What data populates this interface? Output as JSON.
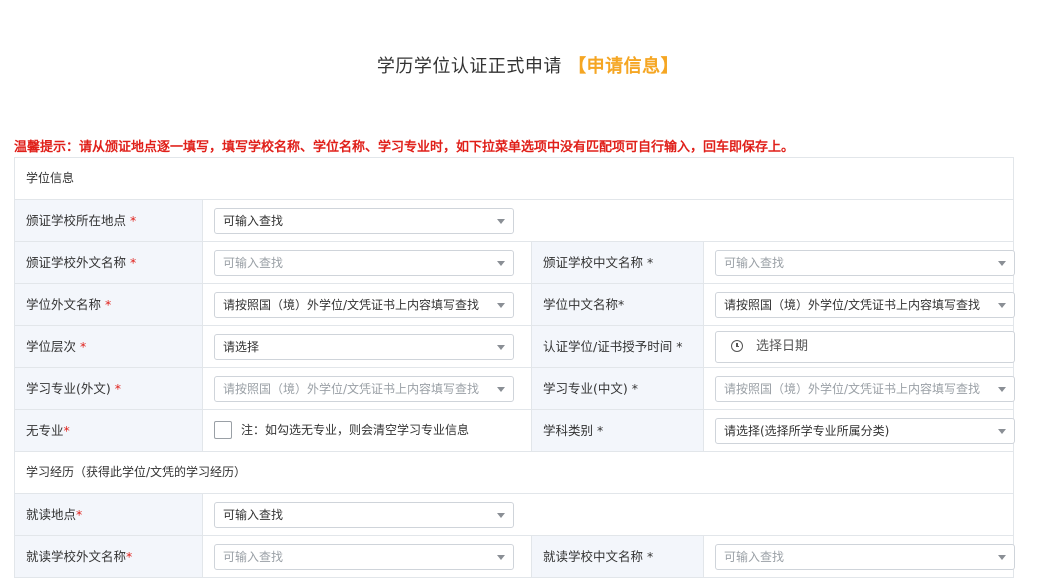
{
  "page": {
    "title_main": "学历学位认证正式申请",
    "title_highlight": "【申请信息】"
  },
  "tip": "温馨提示：请从颁证地点逐一填写，填写学校名称、学位名称、学习专业时，如下拉菜单选项中没有匹配项可自行输入，回车即保存上。",
  "colors": {
    "highlight": "#f5a623",
    "warning": "#e0201a",
    "label_bg": "#f3f6fb"
  },
  "sections": {
    "degree_info": "学位信息",
    "study_experience": "学习经历（获得此学位/文凭的学习经历）"
  },
  "fields": {
    "issuing_location": {
      "label": "颁证学校所在地点",
      "req": "*",
      "value": "可输入查找"
    },
    "issuing_school_foreign": {
      "label": "颁证学校外文名称",
      "req": "*",
      "placeholder": "可输入查找"
    },
    "issuing_school_chinese": {
      "label": "颁证学校中文名称",
      "req": "*",
      "placeholder": "可输入查找"
    },
    "degree_foreign": {
      "label": "学位外文名称",
      "req": "*",
      "value": "请按照国（境）外学位/文凭证书上内容填写查找"
    },
    "degree_chinese": {
      "label": "学位中文名称",
      "req": "*",
      "value": "请按照国（境）外学位/文凭证书上内容填写查找"
    },
    "degree_level": {
      "label": "学位层次",
      "req": "*",
      "value": "请选择"
    },
    "award_date": {
      "label": "认证学位/证书授予时间",
      "req": "*",
      "placeholder": "选择日期"
    },
    "major_foreign": {
      "label": "学习专业(外文)",
      "req": "*",
      "placeholder": "请按照国（境）外学位/文凭证书上内容填写查找"
    },
    "major_chinese": {
      "label": "学习专业(中文)",
      "req": "*",
      "placeholder": "请按照国（境）外学位/文凭证书上内容填写查找"
    },
    "no_major": {
      "label": "无专业",
      "req": "*",
      "note": "注：如勾选无专业，则会清空学习专业信息"
    },
    "discipline": {
      "label": "学科类别",
      "req": "*",
      "value": "请选择(选择所学专业所属分类)"
    },
    "study_location": {
      "label": "就读地点",
      "req": "*",
      "value": "可输入查找"
    },
    "study_school_foreign": {
      "label": "就读学校外文名称",
      "req": "*",
      "placeholder": "可输入查找"
    },
    "study_school_chinese": {
      "label": "就读学校中文名称",
      "req": "*",
      "placeholder": "可输入查找"
    }
  }
}
